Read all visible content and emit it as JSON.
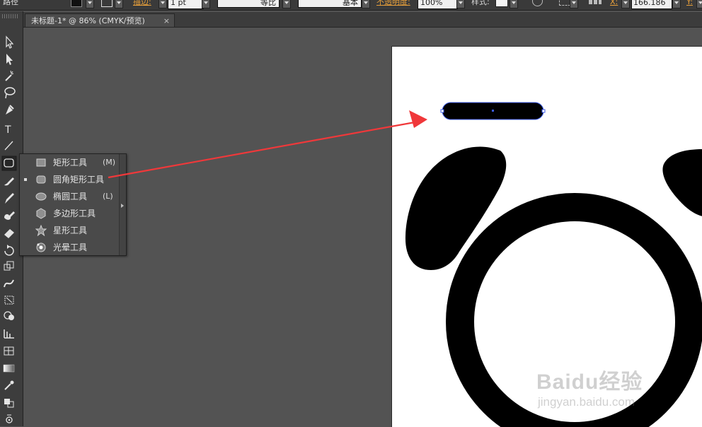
{
  "control_bar": {
    "path_label": "路径",
    "stroke_label": "描边:",
    "stroke_weight": "1 pt",
    "profile_label": "等比",
    "brush_label": "基本",
    "opacity_label": "不透明度:",
    "opacity_value": "100%",
    "style_label": "样式:",
    "x_label": "X:",
    "x_value": "166.186",
    "y_label": "Y:"
  },
  "document_tab": {
    "title": "未标题-1* @ 86% (CMYK/预览)",
    "close": "×"
  },
  "tools": [
    {
      "name": "selection-tool"
    },
    {
      "name": "direct-selection-tool"
    },
    {
      "name": "magic-wand-tool"
    },
    {
      "name": "lasso-tool"
    },
    {
      "name": "pen-tool"
    },
    {
      "name": "type-tool",
      "glyph": "T"
    },
    {
      "name": "line-segment-tool"
    },
    {
      "name": "rounded-rectangle-tool",
      "active": true
    },
    {
      "name": "paintbrush-tool"
    },
    {
      "name": "pencil-tool"
    },
    {
      "name": "blob-brush-tool"
    },
    {
      "name": "eraser-tool"
    },
    {
      "name": "rotate-tool"
    },
    {
      "name": "scale-tool"
    },
    {
      "name": "warp-tool"
    },
    {
      "name": "free-transform-tool"
    },
    {
      "name": "shape-builder-tool"
    },
    {
      "name": "perspective-grid-tool"
    },
    {
      "name": "mesh-tool"
    },
    {
      "name": "gradient-tool"
    },
    {
      "name": "eyedropper-tool"
    },
    {
      "name": "blend-tool"
    },
    {
      "name": "symbol-sprayer-tool"
    }
  ],
  "flyout_menu": {
    "items": [
      {
        "label": "矩形工具",
        "shortcut": "(M)",
        "icon": "rectangle-icon",
        "selected": false
      },
      {
        "label": "圆角矩形工具",
        "shortcut": "",
        "icon": "rounded-rectangle-icon",
        "selected": true
      },
      {
        "label": "椭圆工具",
        "shortcut": "(L)",
        "icon": "ellipse-icon",
        "selected": false
      },
      {
        "label": "多边形工具",
        "shortcut": "",
        "icon": "polygon-icon",
        "selected": false
      },
      {
        "label": "星形工具",
        "shortcut": "",
        "icon": "star-icon",
        "selected": false
      },
      {
        "label": "光晕工具",
        "shortcut": "",
        "icon": "flare-icon",
        "selected": false
      }
    ]
  },
  "annotation": {
    "color": "#f0383a"
  },
  "watermark": {
    "main": "Baidu经验",
    "sub": "jingyan.baidu.com"
  },
  "colors": {
    "ui_dark": "#3a3a3a",
    "canvas_gray": "#535353",
    "selection_blue": "#3d5ce8",
    "accent_orange": "#e8a03a"
  }
}
